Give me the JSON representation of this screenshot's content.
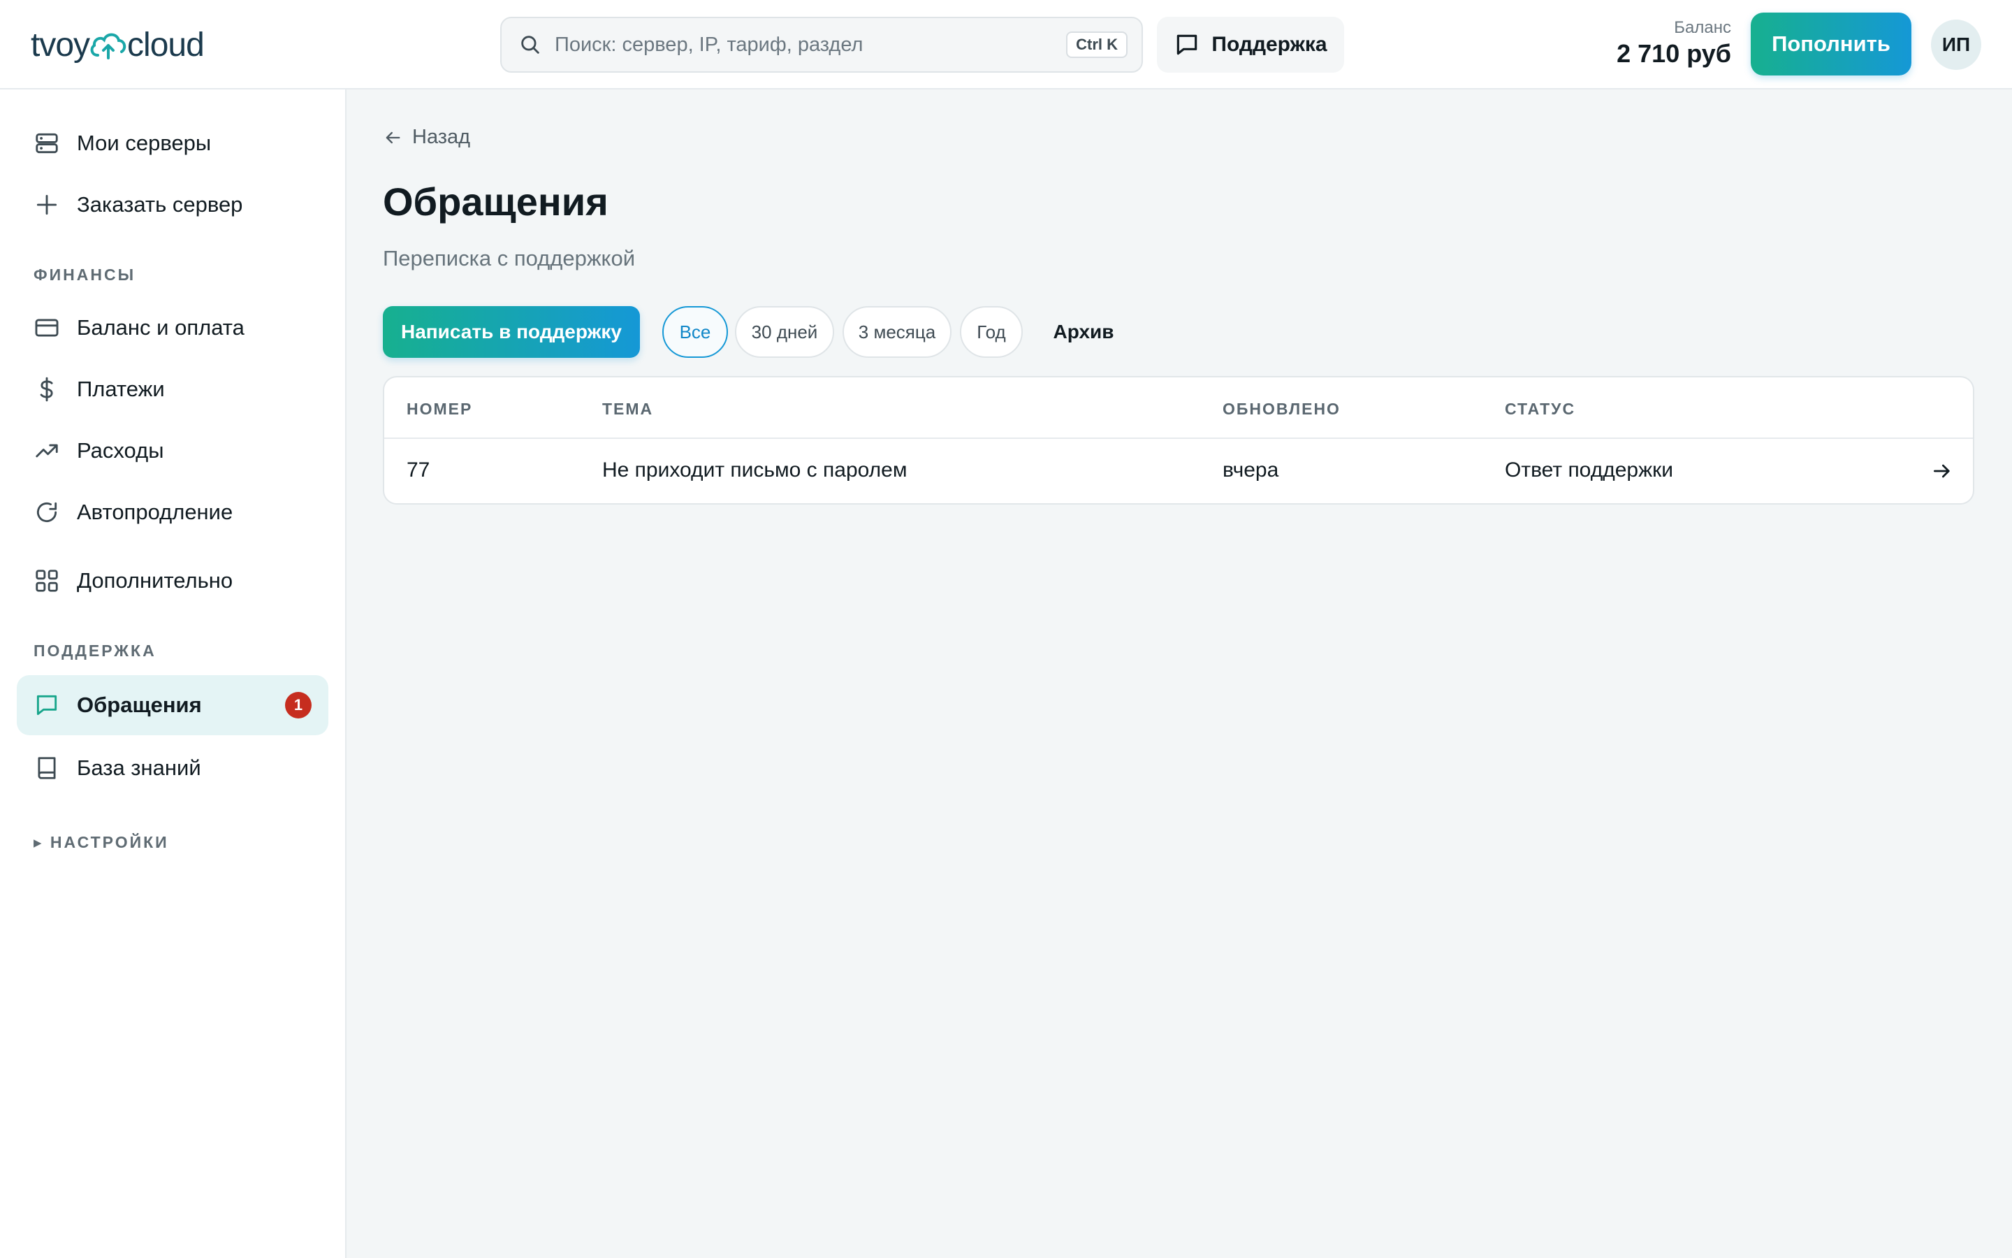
{
  "header": {
    "logo_left": "tvoy",
    "logo_right": "cloud",
    "search": {
      "placeholder": "Поиск: сервер, IP, тариф, раздел",
      "shortcut": "Ctrl K"
    },
    "support_label": "Поддержка",
    "balance_label": "Баланс",
    "balance_value": "2 710 руб",
    "topup_label": "Пополнить",
    "avatar_initials": "ИП"
  },
  "sidebar": {
    "items": [
      {
        "label": "Мои серверы",
        "icon": "server-icon"
      },
      {
        "label": "Заказать сервер",
        "icon": "plus-icon"
      },
      {
        "label": "Баланс и оплата",
        "icon": "credit-card-icon"
      },
      {
        "label": "Платежи",
        "icon": "dollar-icon"
      },
      {
        "label": "Расходы",
        "icon": "trending-up-icon"
      },
      {
        "label": "Автопродление",
        "icon": "refresh-icon"
      },
      {
        "label": "Дополнительно",
        "icon": "grid-icon"
      },
      {
        "label": "Обращения",
        "icon": "chat-icon",
        "badge": "1",
        "active": true
      },
      {
        "label": "База знаний",
        "icon": "book-icon"
      }
    ],
    "sections": {
      "finance": "ФИНАНСЫ",
      "support": "ПОДДЕРЖКА",
      "settings": "▸ НАСТРОЙКИ"
    }
  },
  "main": {
    "back_label": "Назад",
    "title": "Обращения",
    "subtitle": "Переписка с поддержкой",
    "new_ticket_label": "Написать в поддержку",
    "filters": [
      {
        "label": "Все",
        "active": true
      },
      {
        "label": "30 дней"
      },
      {
        "label": "3 месяца"
      },
      {
        "label": "Год"
      },
      {
        "label": "Архив"
      }
    ],
    "table": {
      "columns": [
        "НОМЕР",
        "ТЕМА",
        "ОБНОВЛЕНО",
        "СТАТУС"
      ],
      "rows": [
        {
          "number": "77",
          "subject": "Не приходит письмо с паролем",
          "updated": "вчера",
          "status": "Ответ поддержки"
        }
      ]
    }
  },
  "colors": {
    "accent_teal": "#17b08f",
    "accent_blue": "#1598d6",
    "badge_red": "#c62d1f",
    "active_bg": "#e4f4f5"
  }
}
